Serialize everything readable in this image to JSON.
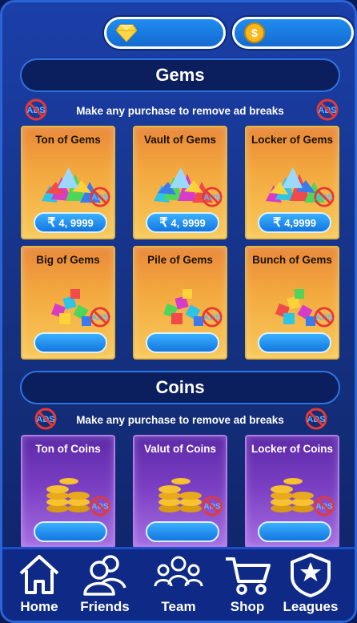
{
  "topbar": {
    "gem_icon": "diamond-icon",
    "coin_icon": "coin-icon"
  },
  "gems": {
    "title": "Gems",
    "notice": "Make any purchase to remove ad breaks",
    "cards": [
      {
        "name": "Ton of Gems",
        "price": "4, 9999",
        "currency": "₹"
      },
      {
        "name": "Vault of Gems",
        "price": "4, 9999",
        "currency": "₹"
      },
      {
        "name": "Locker of Gems",
        "price": "4,9999",
        "currency": "₹"
      },
      {
        "name": "Big of Gems",
        "price": "",
        "currency": ""
      },
      {
        "name": "Pile of Gems",
        "price": "",
        "currency": ""
      },
      {
        "name": "Bunch of Gems",
        "price": "",
        "currency": ""
      }
    ]
  },
  "coins": {
    "title": "Coins",
    "notice": "Make any purchase to remove ad breaks",
    "cards": [
      {
        "name": "Ton of Coins",
        "price": ""
      },
      {
        "name": "Valut of Coins",
        "price": ""
      },
      {
        "name": "Locker of Coins",
        "price": ""
      }
    ]
  },
  "nav": {
    "items": [
      {
        "label": "Home",
        "icon": "home-icon"
      },
      {
        "label": "Friends",
        "icon": "friends-icon"
      },
      {
        "label": "Team",
        "icon": "team-icon"
      },
      {
        "label": "Shop",
        "icon": "cart-icon"
      },
      {
        "label": "Leagues",
        "icon": "shield-star-icon"
      }
    ]
  },
  "colors": {
    "background": "#14307f",
    "accent_blue": "#1f8df0",
    "gem_card": "#f3a83e",
    "coin_card": "#7a3ec2"
  }
}
